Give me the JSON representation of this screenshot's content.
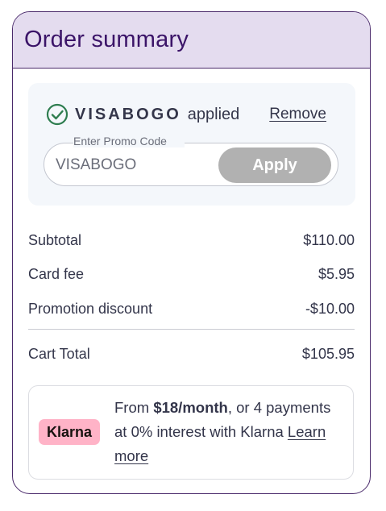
{
  "order_summary": {
    "title": "Order summary"
  },
  "promo": {
    "code": "VISABOGO",
    "applied_text": "applied",
    "remove_label": "Remove",
    "field_label": "Enter Promo Code",
    "input_value": "VISABOGO",
    "apply_label": "Apply",
    "check_icon": "check-circle-icon"
  },
  "summary": {
    "subtotal": {
      "label": "Subtotal",
      "value": "$110.00"
    },
    "card_fee": {
      "label": "Card fee",
      "value": "$5.95"
    },
    "discount": {
      "label": "Promotion discount",
      "value": "-$10.00"
    },
    "total": {
      "label": "Cart Total",
      "value": "$105.95"
    }
  },
  "klarna": {
    "badge": "Klarna",
    "text_prefix": "From ",
    "text_amount": "$18/month",
    "text_middle": ", or 4 payments at 0% interest with Klarna ",
    "learn_more": "Learn more"
  },
  "colors": {
    "header_bg": "#e4dcef",
    "title": "#3b1468",
    "check": "#2e7d4f",
    "apply_bg": "#b1b1b1",
    "klarna_pink": "#ffb3c7"
  }
}
